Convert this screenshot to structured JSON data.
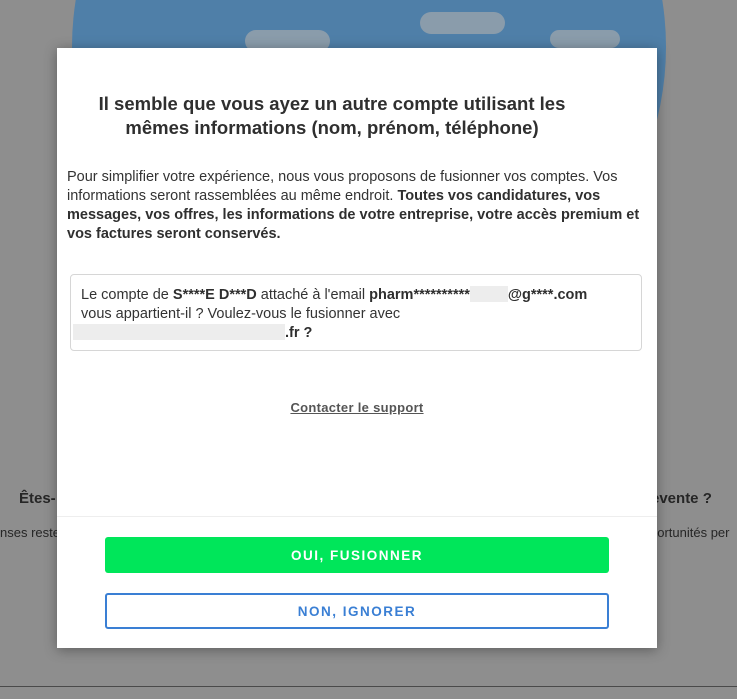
{
  "background": {
    "heading_left": "Êtes-",
    "heading_right": "evente ?",
    "text_left": "nses reste",
    "text_right": "portunités per"
  },
  "modal": {
    "title": "Il semble que vous ayez un autre compte utilisant les mêmes informations (nom, prénom, téléphone)",
    "intro_text": "Pour simplifier votre expérience, nous vous proposons de fusionner vos comptes. Vos informations seront rassemblées au même endroit.",
    "intro_bold": "Toutes vos candidatures, vos messages, vos offres, les informations de votre entreprise, votre accès premium et vos factures seront conservés.",
    "account": {
      "prefix": "Le compte de",
      "name": "S****E D***D",
      "attached": "attaché à l'email",
      "email_start": "pharm**********",
      "email_end": "@g****.com",
      "question": "vous appartient-il ? Voulez-vous le fusionner avec",
      "target_end": ".fr ?"
    },
    "support_link": "Contacter le support",
    "primary_button": "OUI, FUSIONNER",
    "secondary_button": "NON, IGNORER"
  },
  "colors": {
    "primary": "#00e65a",
    "secondary": "#3a7fd4",
    "overlay": "#8e8e8e"
  }
}
